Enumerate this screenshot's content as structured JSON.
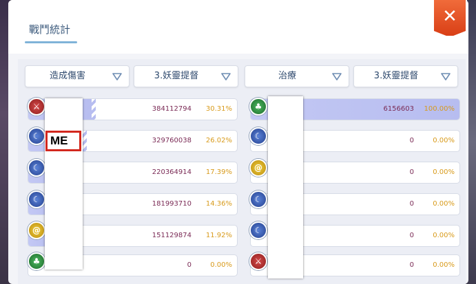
{
  "window": {
    "title": "戰鬥統計",
    "close_glyph": "✕"
  },
  "left_panel": {
    "metric_dropdown": {
      "selected": "造成傷害"
    },
    "filter_dropdown": {
      "selected": "3.妖靈提督"
    },
    "rows": [
      {
        "job_icon": "red-sword-job-icon",
        "value": "384112794",
        "percent": "30.31%",
        "share": 0.3031
      },
      {
        "job_icon": "blue-crescent-job-icon",
        "value": "329760038",
        "percent": "26.02%",
        "share": 0.2602
      },
      {
        "job_icon": "blue-crescent-job-icon",
        "value": "220364914",
        "percent": "17.39%",
        "share": 0.1739
      },
      {
        "job_icon": "blue-crescent-job-icon",
        "value": "181993710",
        "percent": "14.36%",
        "share": 0.1436
      },
      {
        "job_icon": "yellow-swirl-job-icon",
        "value": "151129874",
        "percent": "11.92%",
        "share": 0.1192
      },
      {
        "job_icon": "green-leaf-job-icon",
        "value": "0",
        "percent": "0.00%",
        "share": 0
      }
    ]
  },
  "right_panel": {
    "metric_dropdown": {
      "selected": "治療"
    },
    "filter_dropdown": {
      "selected": "3.妖靈提督"
    },
    "rows": [
      {
        "job_icon": "green-leaf-job-icon",
        "value": "6156603",
        "percent": "100.00%",
        "share": 1.0
      },
      {
        "job_icon": "blue-crescent-job-icon",
        "value": "0",
        "percent": "0.00%",
        "share": 0
      },
      {
        "job_icon": "yellow-swirl-job-icon",
        "value": "0",
        "percent": "0.00%",
        "share": 0
      },
      {
        "job_icon": "blue-crescent-job-icon",
        "value": "0",
        "percent": "0.00%",
        "share": 0
      },
      {
        "job_icon": "blue-crescent-job-icon",
        "value": "0",
        "percent": "0.00%",
        "share": 0
      },
      {
        "job_icon": "red-sword-job-icon",
        "value": "0",
        "percent": "0.00%",
        "share": 0
      }
    ]
  },
  "annotation": {
    "label": "ME"
  },
  "colors": {
    "value_text": "#7a2a55",
    "percent_text": "#d89a1a",
    "bar_fill": "#b7bdf0",
    "close_button": "#e5532a",
    "highlight_box": "#d2281e"
  }
}
